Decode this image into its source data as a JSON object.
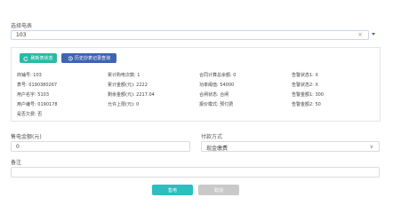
{
  "meter": {
    "label": "选择电表",
    "value": "103",
    "clear_symbol": "×"
  },
  "toolbar": {
    "refresh_label": "刷新表状态",
    "refresh_icon": "refresh-icon",
    "history_label": "历史抄表记录查询",
    "history_icon": "history-icon",
    "refresh_color": "#2bb9a4",
    "history_color": "#3f64b4"
  },
  "info": {
    "row1": [
      "商铺号: 103",
      "累计购电次数: 1",
      "合同计算总余额: 0",
      "告警状态1: X"
    ],
    "row2": [
      "表号: 0190380267",
      "累计金额(元): 2222",
      "功率阈值: 54000",
      "告警状态2: X"
    ],
    "row3": [
      "用户名字: 5103",
      "剩余金额(元): 2217.04",
      "合闸状态: 合闸",
      "告警金额1: 300"
    ],
    "row4": [
      "用户编号: 0190178",
      "允许上限(元): 0",
      "报价模式: 预付费",
      "告警金额2: 50"
    ],
    "row5": [
      "是否欠费: 否"
    ]
  },
  "form": {
    "amount_label": "售电金额(元)",
    "amount_value": "0",
    "payment_label": "付款方式",
    "payment_value": "现金缴费",
    "remark_label": "备注",
    "remark_value": ""
  },
  "actions": {
    "submit_label": "售电",
    "cancel_label": "取消",
    "submit_color": "#2bbfbf",
    "cancel_color": "#c9c9c9"
  }
}
